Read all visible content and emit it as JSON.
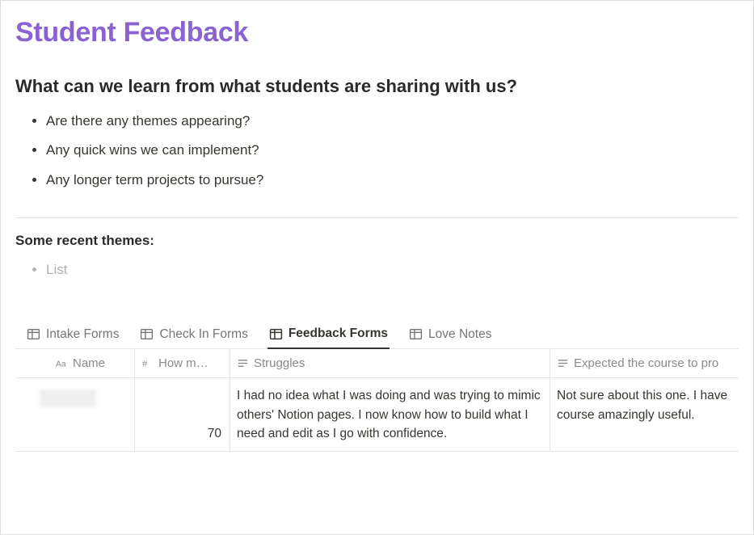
{
  "title": "Student Feedback",
  "heading": "What can we learn from what students are sharing with us?",
  "questions": [
    "Are there any themes appearing?",
    "Any quick wins we can implement?",
    "Any longer term projects to pursue?"
  ],
  "themes_heading": "Some recent themes:",
  "themes_placeholder": "List",
  "tabs": [
    {
      "label": "Intake Forms"
    },
    {
      "label": "Check In Forms"
    },
    {
      "label": "Feedback Forms"
    },
    {
      "label": "Love Notes"
    }
  ],
  "columns": {
    "name": "Name",
    "how_many": "How m…",
    "struggles": "Struggles",
    "expected": "Expected the course to pro"
  },
  "rows": [
    {
      "name": "",
      "how_many": "70",
      "struggles": "I had no idea what I was doing and was trying to mimic others' Notion pages. I now know how to build what I need and edit as I go with confidence.",
      "expected": "Not sure about this one. I have course amazingly useful."
    }
  ]
}
